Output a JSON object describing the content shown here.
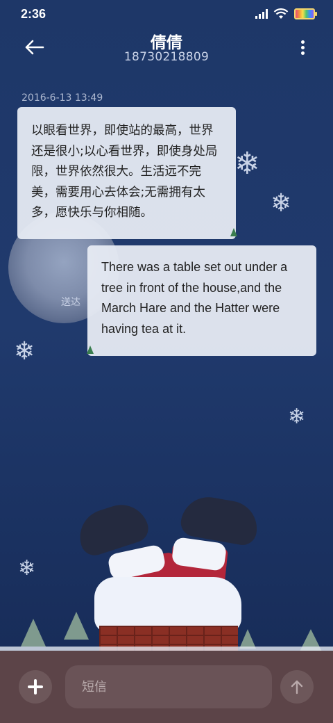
{
  "status_bar": {
    "time": "2:36",
    "icons": [
      "signal-icon",
      "wifi-icon",
      "battery-icon"
    ]
  },
  "header": {
    "contact_name": "倩倩",
    "contact_number": "18730218809",
    "back_icon": "back-arrow-icon",
    "more_icon": "more-vertical-icon"
  },
  "messages": [
    {
      "direction": "incoming",
      "timestamp": "2016-6-13 13:49",
      "text": "以眼看世界，即使站的最高，世界还是很小;以心看世界，即使身处局限，世界依然很大。生活远不完美，需要用心去体会;无需拥有太多，愿快乐与你相随。"
    },
    {
      "direction": "outgoing",
      "status": "送达",
      "text": "There was a table set out under a tree in front of the house,and the March Hare and the Hatter were having tea at it."
    }
  ],
  "composer": {
    "add_icon": "plus-icon",
    "placeholder": "短信",
    "send_icon": "send-arrow-icon"
  },
  "colors": {
    "background": "#203a6d",
    "bubble": "#e8ecf4",
    "input_bar": "#5c4448"
  }
}
